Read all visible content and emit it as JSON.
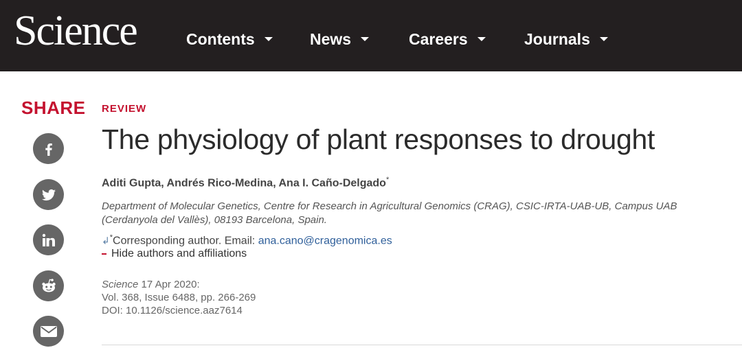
{
  "header": {
    "logo": "Science",
    "nav": [
      {
        "label": "Contents"
      },
      {
        "label": "News"
      },
      {
        "label": "Careers"
      },
      {
        "label": "Journals"
      }
    ]
  },
  "share": {
    "label": "SHARE",
    "icons": [
      "facebook-icon",
      "twitter-icon",
      "linkedin-icon",
      "reddit-icon",
      "email-icon"
    ]
  },
  "article": {
    "kicker": "REVIEW",
    "title": "The physiology of plant responses to drought",
    "authors": "Aditi Gupta, Andrés Rico-Medina, Ana I. Caño-Delgado",
    "authors_marker": "*",
    "affiliation": "Department of Molecular Genetics, Centre for Research in Agricultural Genomics (CRAG), CSIC-IRTA-UAB-UB, Campus UAB (Cerdanyola del Vallès), 08193 Barcelona, Spain.",
    "corresponding_marker": "*",
    "corresponding_text": "Corresponding author. Email: ",
    "corresponding_email": "ana.cano@cragenomica.es",
    "hide_link": "Hide authors and affiliations",
    "citation": {
      "journal": "Science",
      "date": " 17 Apr 2020:",
      "volume": "Vol. 368, Issue 6488, pp. 266-269",
      "doi": "DOI: 10.1126/science.aaz7614"
    }
  },
  "colors": {
    "topbar": "#231f20",
    "accent": "#c4122f",
    "share_icon_bg": "#666666",
    "link": "#2f5f9a"
  }
}
